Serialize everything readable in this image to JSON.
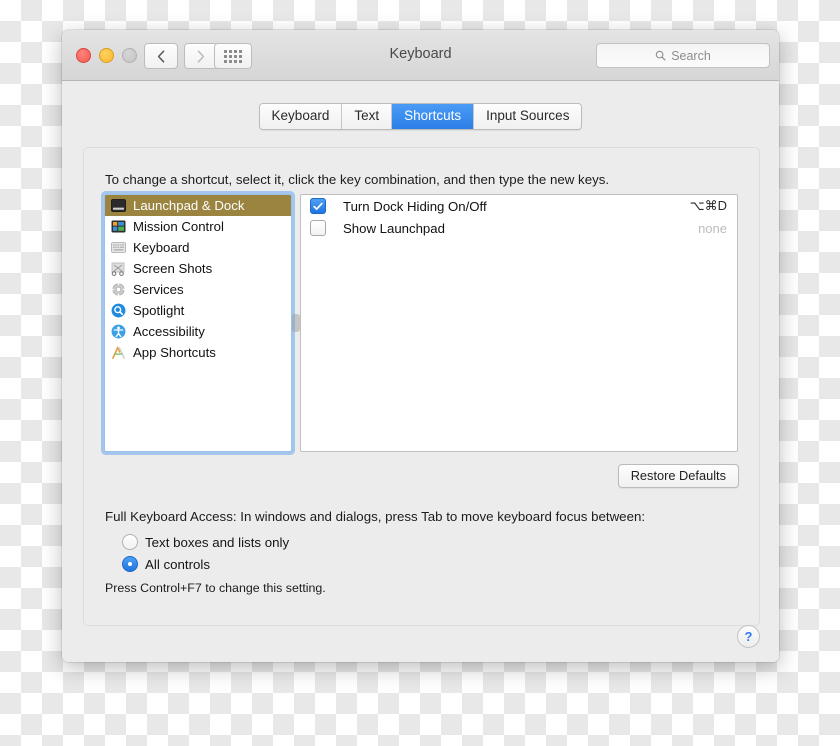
{
  "window": {
    "title": "Keyboard",
    "traffic_lights": [
      "close-red",
      "minimize-yellow",
      "zoom-grey"
    ],
    "back_label": "‹",
    "forward_label": "›",
    "show_all_label": "show-all-grid"
  },
  "search": {
    "placeholder": "Search",
    "icon": "search-icon"
  },
  "tabs": [
    {
      "label": "Keyboard",
      "active": false
    },
    {
      "label": "Text",
      "active": false
    },
    {
      "label": "Shortcuts",
      "active": true
    },
    {
      "label": "Input Sources",
      "active": false
    }
  ],
  "instructions": "To change a shortcut, select it, click the key combination, and then type the new keys.",
  "categories": [
    {
      "label": "Launchpad & Dock",
      "icon": "dock-icon",
      "selected": true
    },
    {
      "label": "Mission Control",
      "icon": "mission-control-icon",
      "selected": false
    },
    {
      "label": "Keyboard",
      "icon": "keyboard-icon",
      "selected": false
    },
    {
      "label": "Screen Shots",
      "icon": "screenshots-icon",
      "selected": false
    },
    {
      "label": "Services",
      "icon": "services-gear-icon",
      "selected": false
    },
    {
      "label": "Spotlight",
      "icon": "spotlight-icon",
      "selected": false
    },
    {
      "label": "Accessibility",
      "icon": "accessibility-icon",
      "selected": false
    },
    {
      "label": "App Shortcuts",
      "icon": "app-shortcuts-icon",
      "selected": false
    }
  ],
  "shortcuts": [
    {
      "name": "Turn Dock Hiding On/Off",
      "combo": "⌥⌘D",
      "checked": true,
      "is_none": false
    },
    {
      "name": "Show Launchpad",
      "combo": "none",
      "checked": false,
      "is_none": true
    }
  ],
  "restore_defaults_label": "Restore Defaults",
  "full_keyboard_access": {
    "title": "Full Keyboard Access: In windows and dialogs, press Tab to move keyboard focus between:",
    "options": [
      {
        "label": "Text boxes and lists only",
        "selected": false
      },
      {
        "label": "All controls",
        "selected": true
      }
    ],
    "hint": "Press Control+F7 to change this setting."
  },
  "help_label": "?",
  "colors": {
    "tab_active": "#2c7fe8",
    "selection_olive": "#9a8440",
    "focus_ring": "#78afeb",
    "checkbox_blue": "#1f75e0",
    "help_blue": "#3478f6"
  }
}
